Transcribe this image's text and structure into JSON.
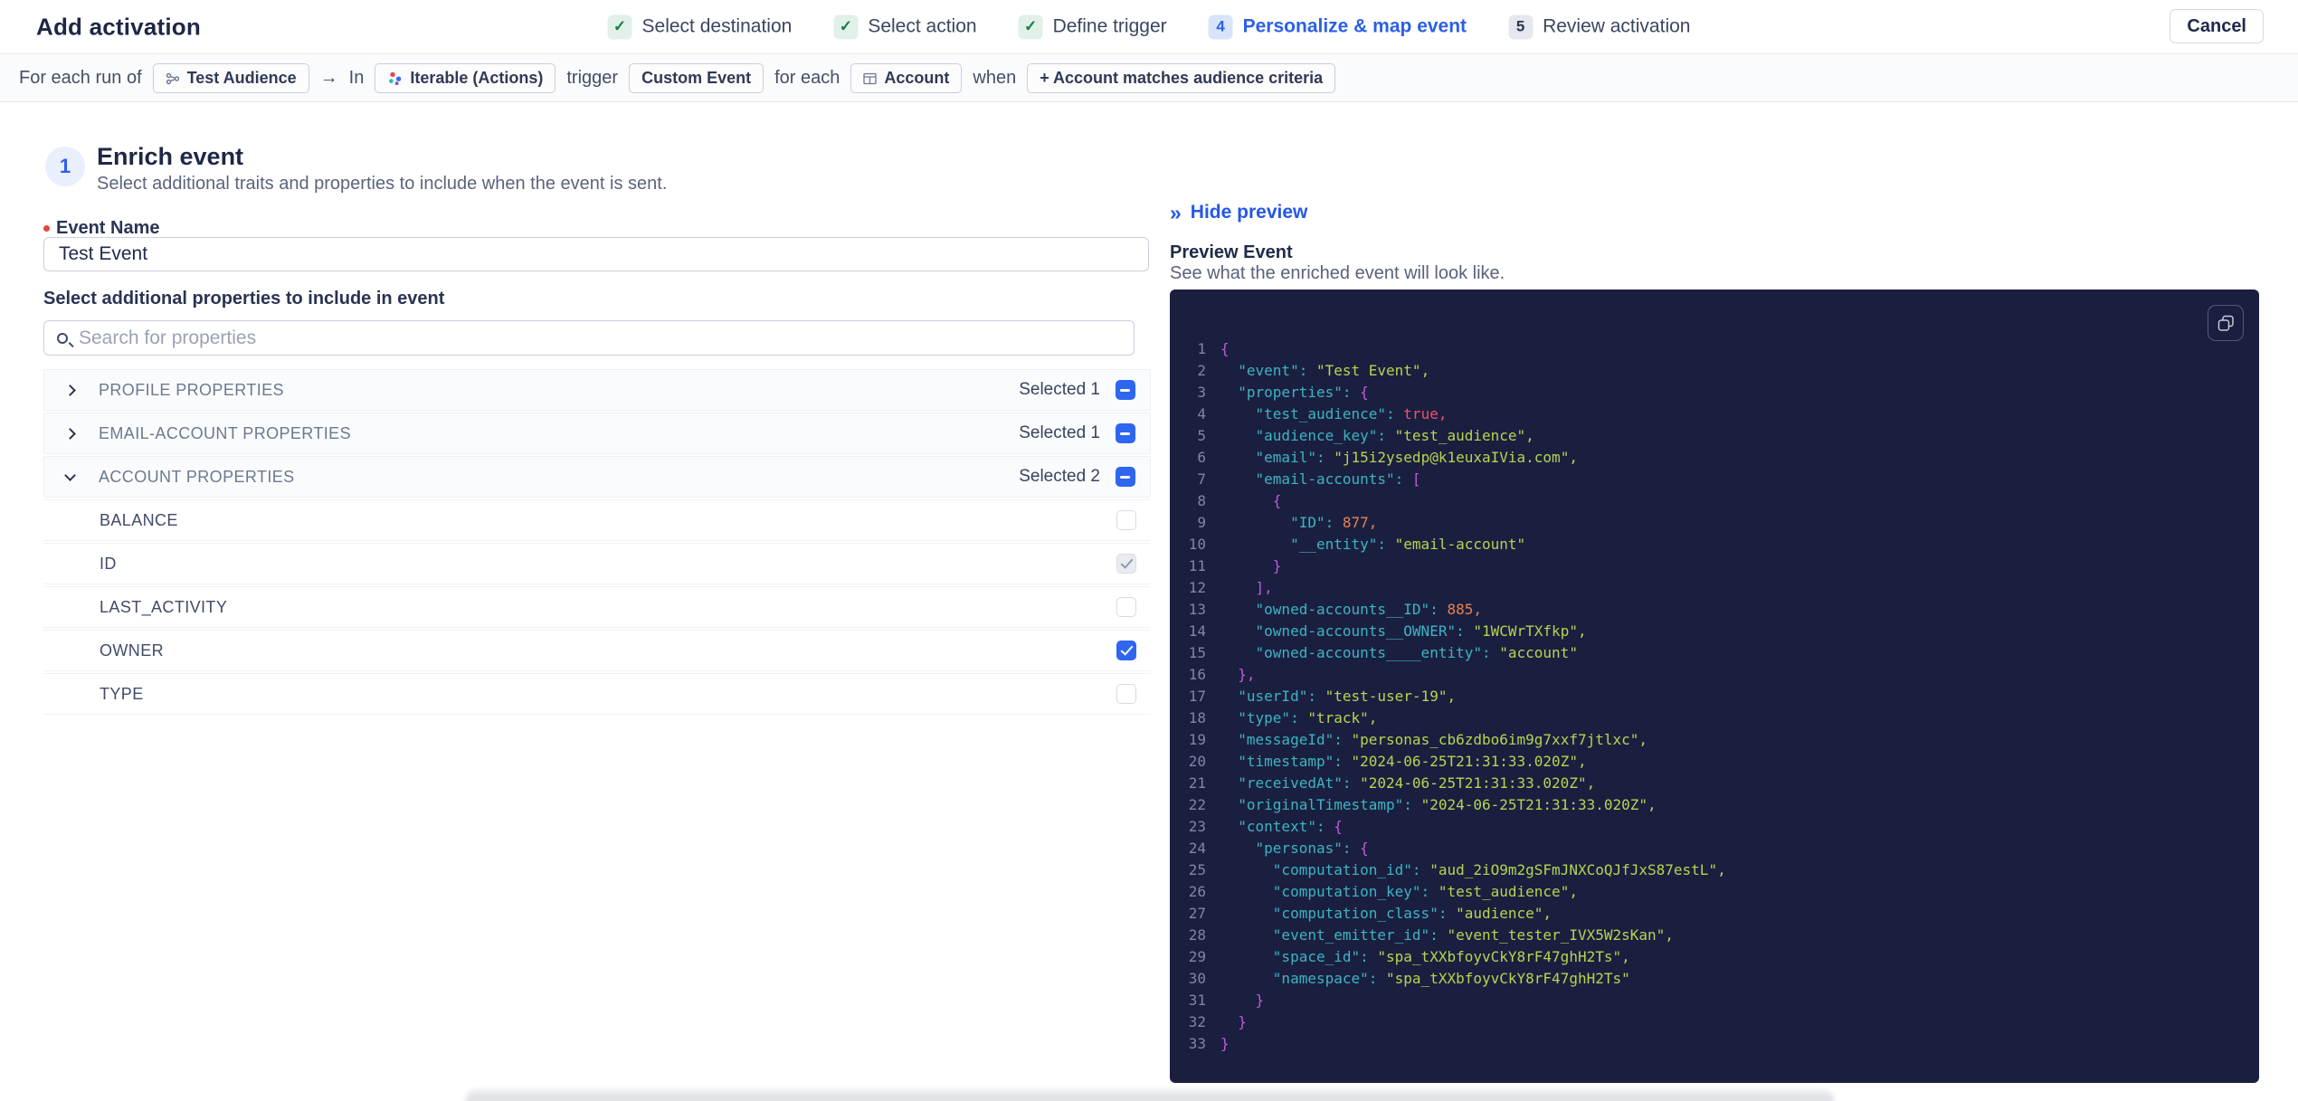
{
  "header": {
    "title": "Add activation",
    "cancel_label": "Cancel",
    "steps": [
      {
        "badge": "✓",
        "label": "Select destination",
        "cls": "done"
      },
      {
        "badge": "✓",
        "label": "Select action",
        "cls": "done"
      },
      {
        "badge": "✓",
        "label": "Define trigger",
        "cls": "done"
      },
      {
        "badge": "4",
        "label": "Personalize & map event",
        "cls": "active"
      },
      {
        "badge": "5",
        "label": "Review activation",
        "cls": "todo"
      }
    ]
  },
  "summary_bar": {
    "prefix": "For each run of",
    "chip_audience": "Test Audience",
    "arrow": "→",
    "in_label": "In",
    "chip_destination": "Iterable (Actions)",
    "trigger_label": "trigger",
    "chip_trigger": "Custom Event",
    "for_each_label": "for each",
    "chip_entity": "Account",
    "when_label": "when",
    "chip_condition": "+ Account matches audience criteria"
  },
  "enrich": {
    "step_number": "1",
    "title": "Enrich event",
    "subtitle": "Select additional traits and properties to include when the event is sent.",
    "event_name_label": "Event Name",
    "event_name_value": "Test Event",
    "properties_label": "Select additional properties to include in event",
    "search_placeholder": "Search for properties",
    "groups": [
      {
        "label": "PROFILE PROPERTIES",
        "selected": "Selected 1",
        "chev_cls": "chev-right"
      },
      {
        "label": "EMAIL-ACCOUNT PROPERTIES",
        "selected": "Selected 1",
        "chev_cls": "chev-right"
      },
      {
        "label": "ACCOUNT PROPERTIES",
        "selected": "Selected 2",
        "chev_cls": "chev-down"
      }
    ],
    "account_properties": [
      {
        "label": "BALANCE",
        "cb_cls": "empty"
      },
      {
        "label": "ID",
        "cb_cls": "disabled"
      },
      {
        "label": "LAST_ACTIVITY",
        "cb_cls": "empty"
      },
      {
        "label": "OWNER",
        "cb_cls": "checked"
      },
      {
        "label": "TYPE",
        "cb_cls": "empty"
      }
    ]
  },
  "preview": {
    "hide_icon": "»",
    "hide_label": "Hide preview",
    "title": "Preview Event",
    "subtitle": "See what the enriched event will look like.",
    "code_lines": [
      {
        "n": 1,
        "k": "",
        "v": "{",
        "c": "p"
      },
      {
        "n": 2,
        "k": "  \"event\": ",
        "v": "\"Test Event\",",
        "c": "s"
      },
      {
        "n": 3,
        "k": "  \"properties\": ",
        "v": "{",
        "c": "p"
      },
      {
        "n": 4,
        "k": "    \"test_audience\": ",
        "v": "true,",
        "c": "b"
      },
      {
        "n": 5,
        "k": "    \"audience_key\": ",
        "v": "\"test_audience\",",
        "c": "s"
      },
      {
        "n": 6,
        "k": "    \"email\": ",
        "v": "\"j15i2ysedp@k1euxaIVia.com\",",
        "c": "s"
      },
      {
        "n": 7,
        "k": "    \"email-accounts\": ",
        "v": "[",
        "c": "p"
      },
      {
        "n": 8,
        "k": "      ",
        "v": "{",
        "c": "p"
      },
      {
        "n": 9,
        "k": "        \"ID\": ",
        "v": "877,",
        "c": "n"
      },
      {
        "n": 10,
        "k": "        \"__entity\": ",
        "v": "\"email-account\"",
        "c": "s"
      },
      {
        "n": 11,
        "k": "      ",
        "v": "}",
        "c": "p"
      },
      {
        "n": 12,
        "k": "    ",
        "v": "],",
        "c": "p"
      },
      {
        "n": 13,
        "k": "    \"owned-accounts__ID\": ",
        "v": "885,",
        "c": "n"
      },
      {
        "n": 14,
        "k": "    \"owned-accounts__OWNER\": ",
        "v": "\"1WCWrTXfkp\",",
        "c": "s"
      },
      {
        "n": 15,
        "k": "    \"owned-accounts____entity\": ",
        "v": "\"account\"",
        "c": "s"
      },
      {
        "n": 16,
        "k": "  ",
        "v": "},",
        "c": "p"
      },
      {
        "n": 17,
        "k": "  \"userId\": ",
        "v": "\"test-user-19\",",
        "c": "s"
      },
      {
        "n": 18,
        "k": "  \"type\": ",
        "v": "\"track\",",
        "c": "s"
      },
      {
        "n": 19,
        "k": "  \"messageId\": ",
        "v": "\"personas_cb6zdbo6im9g7xxf7jtlxc\",",
        "c": "s"
      },
      {
        "n": 20,
        "k": "  \"timestamp\": ",
        "v": "\"2024-06-25T21:31:33.020Z\",",
        "c": "s"
      },
      {
        "n": 21,
        "k": "  \"receivedAt\": ",
        "v": "\"2024-06-25T21:31:33.020Z\",",
        "c": "s"
      },
      {
        "n": 22,
        "k": "  \"originalTimestamp\": ",
        "v": "\"2024-06-25T21:31:33.020Z\",",
        "c": "s"
      },
      {
        "n": 23,
        "k": "  \"context\": ",
        "v": "{",
        "c": "p"
      },
      {
        "n": 24,
        "k": "    \"personas\": ",
        "v": "{",
        "c": "p"
      },
      {
        "n": 25,
        "k": "      \"computation_id\": ",
        "v": "\"aud_2iO9m2gSFmJNXCoQJfJxS87estL\",",
        "c": "s"
      },
      {
        "n": 26,
        "k": "      \"computation_key\": ",
        "v": "\"test_audience\",",
        "c": "s"
      },
      {
        "n": 27,
        "k": "      \"computation_class\": ",
        "v": "\"audience\",",
        "c": "s"
      },
      {
        "n": 28,
        "k": "      \"event_emitter_id\": ",
        "v": "\"event_tester_IVX5W2sKan\",",
        "c": "s"
      },
      {
        "n": 29,
        "k": "      \"space_id\": ",
        "v": "\"spa_tXXbfoyvCkY8rF47ghH2Ts\",",
        "c": "s"
      },
      {
        "n": 30,
        "k": "      \"namespace\": ",
        "v": "\"spa_tXXbfoyvCkY8rF47ghH2Ts\"",
        "c": "s"
      },
      {
        "n": 31,
        "k": "    ",
        "v": "}",
        "c": "p"
      },
      {
        "n": 32,
        "k": "  ",
        "v": "}",
        "c": "p"
      },
      {
        "n": 33,
        "k": "",
        "v": "}",
        "c": "p"
      }
    ],
    "colors": {
      "panel_bg": "#1a1f40",
      "key": "#3db4c2",
      "string": "#b2d74e",
      "punct": "#c05ad6",
      "number": "#e8824f",
      "boolean": "#f2506a",
      "accent_blue": "#2b5fe8",
      "checkbox_blue": "#2e66f0",
      "step_done_green": "#1b7a4a"
    }
  }
}
